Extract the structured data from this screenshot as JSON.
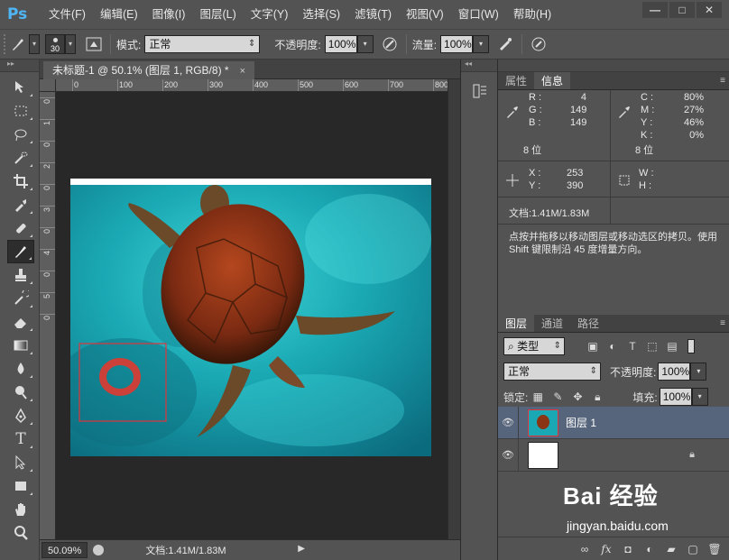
{
  "app": {
    "logo": "Ps"
  },
  "menu": [
    "文件(F)",
    "编辑(E)",
    "图像(I)",
    "图层(L)",
    "文字(Y)",
    "选择(S)",
    "滤镜(T)",
    "视图(V)",
    "窗口(W)",
    "帮助(H)"
  ],
  "window_controls": {
    "minimize": "—",
    "maximize": "□",
    "close": "✕"
  },
  "options": {
    "brush_size": "30",
    "mode_label": "模式:",
    "mode_value": "正常",
    "opacity_label": "不透明度:",
    "opacity_value": "100%",
    "flow_label": "流量:",
    "flow_value": "100%"
  },
  "document": {
    "tab_title": "未标题-1 @ 50.1% (图层 1, RGB/8) *",
    "close": "×",
    "ruler_h": [
      "0",
      "100",
      "200",
      "300",
      "400",
      "500",
      "600",
      "700",
      "800"
    ],
    "ruler_v": [
      "0",
      "1",
      "0",
      "2",
      "0",
      "3",
      "0",
      "4",
      "0",
      "5",
      "0"
    ],
    "zoom": "50.09%",
    "status_doc": "文档:1.41M/1.83M"
  },
  "info_panel": {
    "tabs": [
      "属性",
      "信息"
    ],
    "active_tab": "信息",
    "rgb": {
      "r_label": "R :",
      "r": "4",
      "g_label": "G :",
      "g": "149",
      "b_label": "B :",
      "b": "149",
      "bits": "8 位"
    },
    "cmyk": {
      "c_label": "C :",
      "c": "80%",
      "m_label": "M :",
      "m": "27%",
      "y_label": "Y :",
      "y": "46%",
      "k_label": "K :",
      "k": "0%",
      "bits": "8 位"
    },
    "xy": {
      "x_label": "X :",
      "x": "253",
      "y_label": "Y :",
      "y": "390"
    },
    "wh": {
      "w_label": "W :",
      "w": "",
      "h_label": "H :",
      "h": ""
    },
    "doc": "文档:1.41M/1.83M",
    "hint": "点按并拖移以移动图层或移动选区的拷贝。使用 Shift 键限制沿 45 度增量方向。"
  },
  "layers_panel": {
    "tabs": [
      "图层",
      "通道",
      "路径"
    ],
    "active_tab": "图层",
    "filter_kind": "类型",
    "blend_mode": "正常",
    "opacity_label": "不透明度:",
    "opacity_value": "100%",
    "lock_label": "锁定:",
    "fill_label": "填充:",
    "fill_value": "100%",
    "layers": [
      {
        "name": "图层 1",
        "selected": true
      },
      {
        "name": "",
        "selected": false
      }
    ]
  },
  "watermark": {
    "brand": "Bai 经验",
    "domain": "jingyan.baidu.com"
  },
  "colors": {
    "accent": "#4fb5f5",
    "selected_layer": "#56657c",
    "annotation": "#e0343c"
  }
}
